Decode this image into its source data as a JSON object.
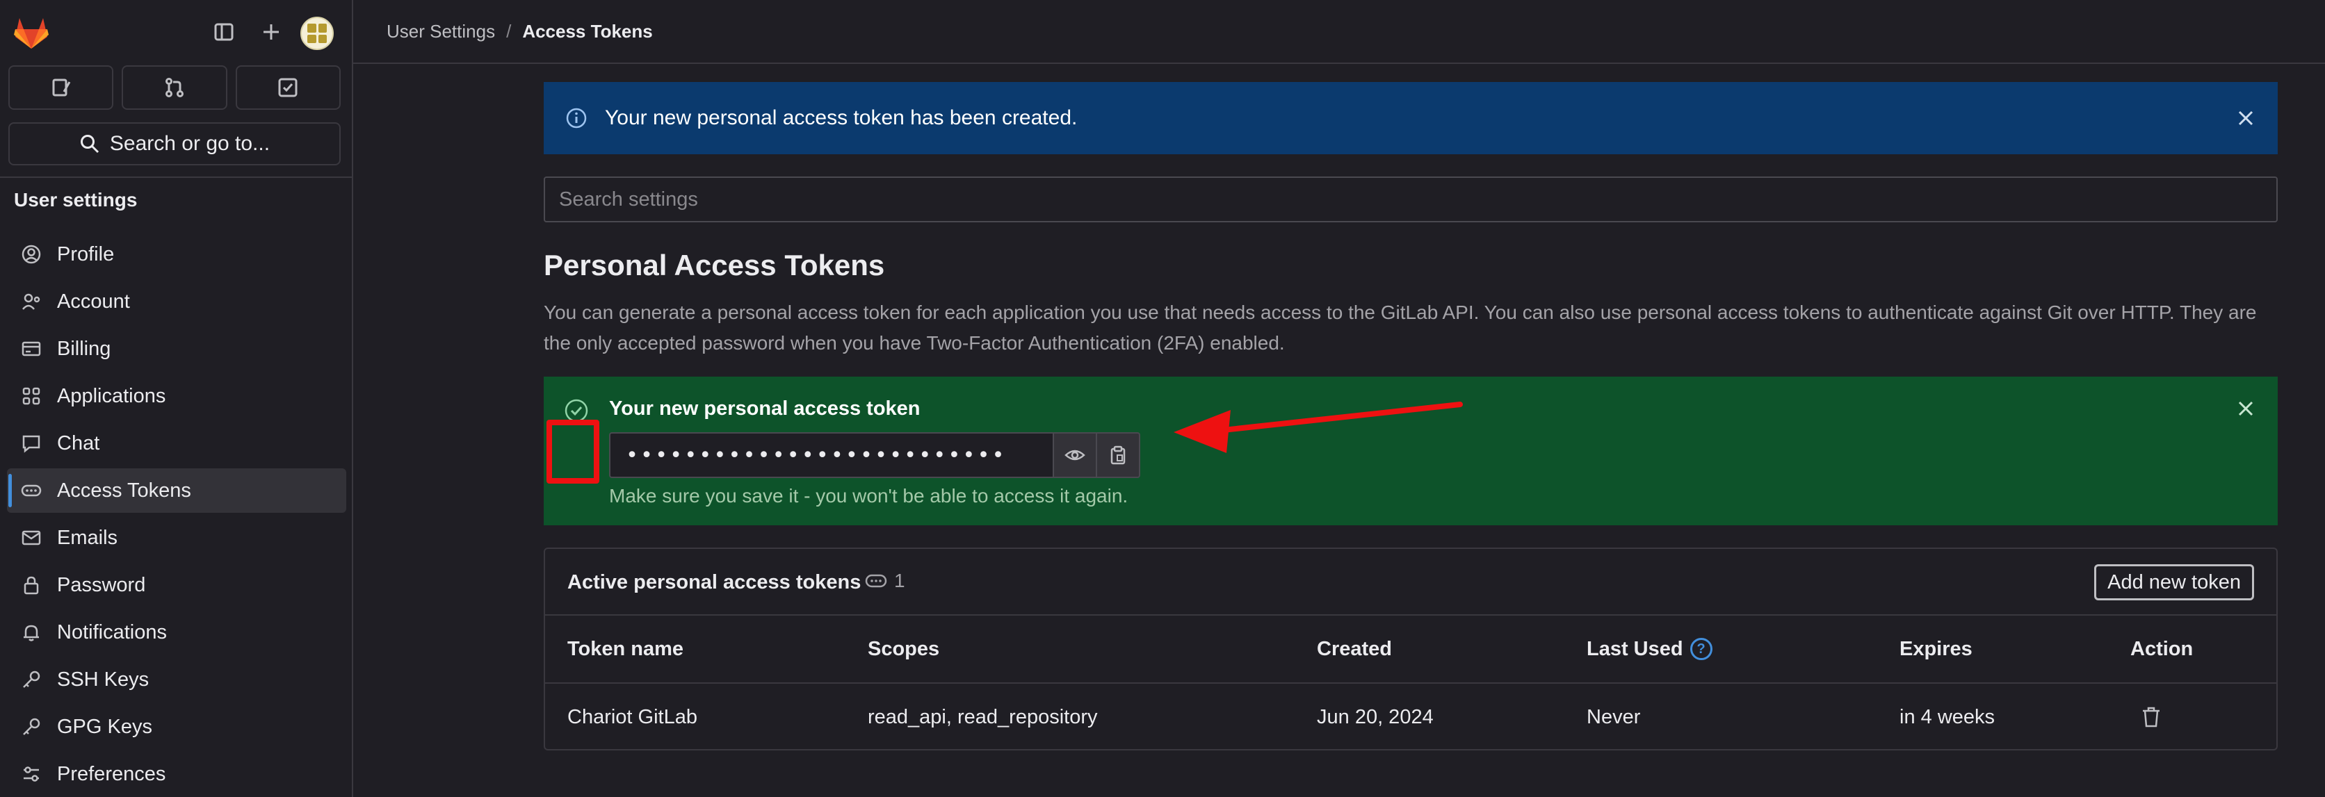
{
  "breadcrumb": {
    "parent": "User Settings",
    "separator": "/",
    "current": "Access Tokens"
  },
  "sidebar": {
    "search_label": "Search or go to...",
    "heading": "User settings",
    "items": [
      {
        "label": "Profile",
        "icon": "profile-icon"
      },
      {
        "label": "Account",
        "icon": "account-icon"
      },
      {
        "label": "Billing",
        "icon": "billing-icon"
      },
      {
        "label": "Applications",
        "icon": "applications-icon"
      },
      {
        "label": "Chat",
        "icon": "chat-icon"
      },
      {
        "label": "Access Tokens",
        "icon": "token-icon",
        "active": true
      },
      {
        "label": "Emails",
        "icon": "mail-icon"
      },
      {
        "label": "Password",
        "icon": "lock-icon"
      },
      {
        "label": "Notifications",
        "icon": "bell-icon"
      },
      {
        "label": "SSH Keys",
        "icon": "key-icon"
      },
      {
        "label": "GPG Keys",
        "icon": "key-icon"
      },
      {
        "label": "Preferences",
        "icon": "preferences-icon"
      }
    ]
  },
  "info_banner": {
    "message": "Your new personal access token has been created."
  },
  "search_settings": {
    "placeholder": "Search settings"
  },
  "page": {
    "title": "Personal Access Tokens",
    "description": "You can generate a personal access token for each application you use that needs access to the GitLab API. You can also use personal access tokens to authenticate against Git over HTTP. They are the only accepted password when you have Two-Factor Authentication (2FA) enabled."
  },
  "new_token": {
    "title": "Your new personal access token",
    "masked_value": "••••••••••••••••••••••••••",
    "hint": "Make sure you save it - you won't be able to access it again."
  },
  "active_tokens": {
    "title": "Active personal access tokens",
    "count": "1",
    "add_button": "Add new token",
    "columns": [
      "Token name",
      "Scopes",
      "Created",
      "Last Used",
      "Expires",
      "Action"
    ],
    "rows": [
      {
        "name": "Chariot GitLab",
        "scopes": "read_api, read_repository",
        "created": "Jun 20, 2024",
        "last_used": "Never",
        "expires": "in 4 weeks"
      }
    ]
  },
  "colors": {
    "background": "#1f1e24",
    "info_banner": "#0b3a6e",
    "success_box": "#0d532a",
    "annotation_red": "#ee1111",
    "accent_blue": "#428fdc"
  }
}
